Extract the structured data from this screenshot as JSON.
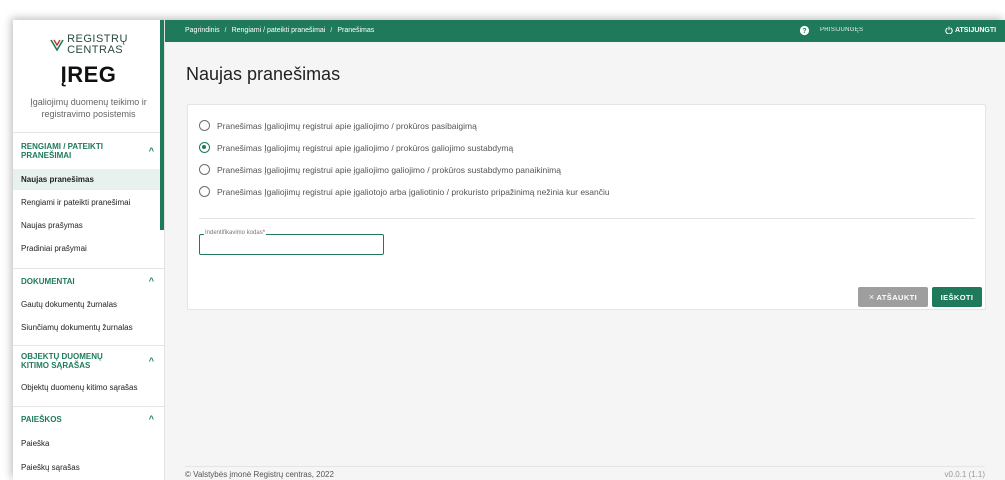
{
  "sidebar": {
    "logo_line1": "REGISTRŲ",
    "logo_line2": "CENTRAS",
    "app_name": "ĮREG",
    "app_desc": "Įgaliojimų duomenų teikimo ir registravimo posistemis",
    "sections": [
      {
        "title": "RENGIAMI / PATEIKTI PRANEŠIMAI",
        "items": [
          "Naujas pranešimas",
          "Rengiami ir pateikti pranešimai",
          "Naujas prašymas",
          "Pradiniai prašymai"
        ]
      },
      {
        "title": "DOKUMENTAI",
        "items": [
          "Gautų dokumentų žurnalas",
          "Siunčiamų dokumentų žurnalas"
        ]
      },
      {
        "title": "OBJEKTŲ DUOMENŲ KITIMO SĄRAŠAS",
        "items": [
          "Objektų duomenų kitimo sąrašas"
        ]
      },
      {
        "title": "PAIEŠKOS",
        "items": [
          "Paieška",
          "Paieškų sąrašas"
        ]
      }
    ],
    "active_item": "Naujas pranešimas"
  },
  "topbar": {
    "breadcrumb": [
      "Pagrindinis",
      "Rengiami / pateikti pranešimai",
      "Pranešimas"
    ],
    "breadcrumb_sep": "/",
    "login": "PRISIJUNGĘS",
    "logout": "ATSIJUNGTI"
  },
  "main": {
    "title": "Naujas pranešimas",
    "radios": [
      {
        "label": "Pranešimas Įgaliojimų registrui apie įgaliojimo / prokūros pasibaigimą",
        "checked": false
      },
      {
        "label": "Pranešimas Įgaliojimų registrui apie įgaliojimo / prokūros galiojimo sustabdymą",
        "checked": true
      },
      {
        "label": "Pranešimas Įgaliojimų registrui apie įgaliojimo galiojimo / prokūros sustabdymo panaikinimą",
        "checked": false
      },
      {
        "label": "Pranešimas Įgaliojimų registrui apie įgaliotojo arba įgaliotinio / prokuristo pripažinimą nežinia kur esančiu",
        "checked": false
      }
    ],
    "field_label": "Indentifikavimo kodas",
    "field_required_mark": "*",
    "field_value": "",
    "cancel_label": "ATŠAUKTI",
    "cancel_icon": "×",
    "search_label": "IEŠKOTI"
  },
  "footer": {
    "copyright": "© Valstybės įmonė Registrų centras, 2022",
    "version": "v0.0.1 (1.1)"
  },
  "colors": {
    "brand_green": "#1f7a5c",
    "cancel_grey": "#9e9e9e"
  }
}
